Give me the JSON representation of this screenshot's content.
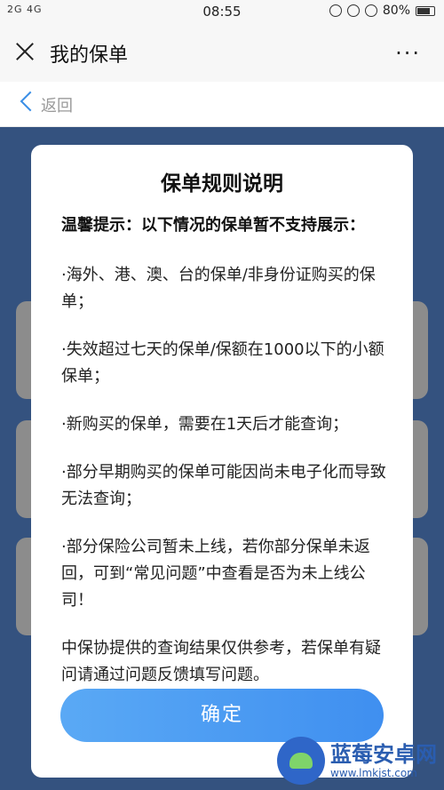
{
  "status_bar": {
    "signal": "2G 4G",
    "time": "08:55",
    "battery": "80%"
  },
  "header": {
    "title": "我的保单",
    "close_icon": "close-icon",
    "more_icon": "more-icon"
  },
  "nav": {
    "back_label": "返回"
  },
  "modal": {
    "title": "保单规则说明",
    "tip_heading": "温馨提示：以下情况的保单暂不支持展示：",
    "rules": [
      "·海外、港、澳、台的保单/非身份证购买的保单；",
      "·失效超过七天的保单/保额在1000以下的小额保单；",
      "·新购买的保单，需要在1天后才能查询；",
      "·部分早期购买的保单可能因尚未电子化而导致无法查询；",
      "·部分保险公司暂未上线，若你部分保单未返回，可到“常见问题”中查看是否为未上线公司！",
      "中保协提供的查询结果仅供参考，若保单有疑问请通过问题反馈填写问题。"
    ],
    "confirm_label": "确定"
  },
  "watermark": {
    "name": "蓝莓安卓网",
    "url": "www.lmkjst.com"
  },
  "colors": {
    "accent": "#3f8ff0",
    "background_page": "#5f95e8",
    "back_chevron": "#3a8ee6"
  }
}
